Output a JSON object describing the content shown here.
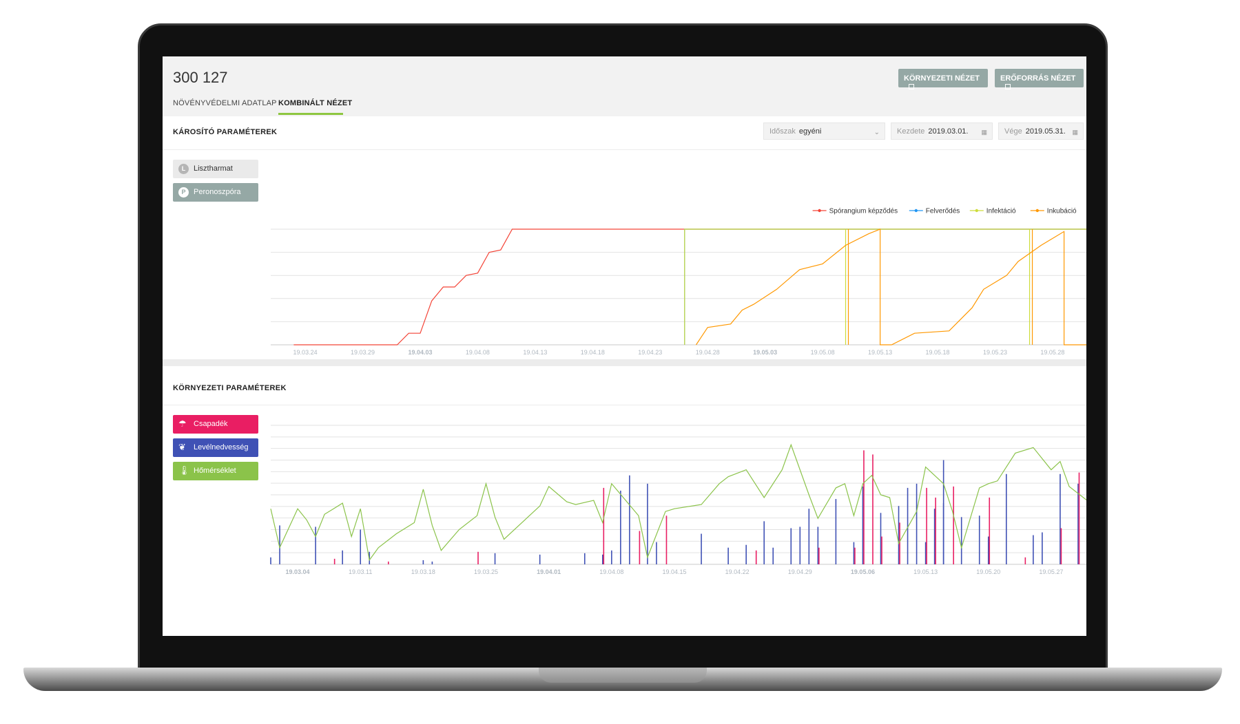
{
  "header": {
    "title": "300 127",
    "tabs": [
      {
        "label": "NÖVÉNYVÉDELMI ADATLAP",
        "active": false
      },
      {
        "label": "KOMBINÁLT NÉZET",
        "active": true
      }
    ],
    "buttons": [
      {
        "label": "KÖRNYEZETI NÉZET",
        "icon": "external-link-icon"
      },
      {
        "label": "ERŐFORRÁS NÉZET",
        "icon": "external-link-icon"
      }
    ]
  },
  "harmful": {
    "title": "KÁROSÍTÓ PARAMÉTEREK",
    "period": {
      "label": "Időszak",
      "value": "egyéni"
    },
    "start": {
      "label": "Kezdete",
      "value": "2019.03.01."
    },
    "end": {
      "label": "Vége",
      "value": "2019.05.31."
    },
    "pathogens": [
      {
        "letter": "L",
        "label": "Lisztharmat"
      },
      {
        "letter": "P",
        "label": "Peronoszpóra"
      }
    ]
  },
  "environment": {
    "title": "KÖRNYEZETI PARAMÉTEREK",
    "params": [
      {
        "label": "Csapadék",
        "icon": "cloud-rain-icon"
      },
      {
        "label": "Levélnedvesség",
        "icon": "leaf-icon"
      },
      {
        "label": "Hőmérséklet",
        "icon": "thermometer-icon"
      }
    ]
  },
  "colors": {
    "accent": "#8dc63f",
    "button_grey": "#95a8a5",
    "sporangium": "#f44336",
    "felverodes": "#2196f3",
    "infekcio": "#cddc39",
    "inkubacio": "#ff9800",
    "csapadek": "#e91e63",
    "levelnedvesseg": "#3f51b5",
    "homerseklet": "#8bc34a"
  },
  "chart_data": [
    {
      "type": "line",
      "x_unit": "date",
      "x_range": [
        "2019-03-21",
        "2019-05-31"
      ],
      "ylim": [
        0,
        100
      ],
      "grid": true,
      "legend_position": "top-right",
      "tick_labels": [
        "19.03.24",
        "19.03.29",
        "19.04.03",
        "19.04.08",
        "19.04.13",
        "19.04.18",
        "19.04.23",
        "19.04.28",
        "19.05.03",
        "19.05.08",
        "19.05.13",
        "19.05.18",
        "19.05.23",
        "19.05.28"
      ],
      "bold_ticks": [
        "19.04.03",
        "19.05.03"
      ],
      "series": [
        {
          "name": "Spórangium képződés",
          "color": "#f44336",
          "points": [
            [
              "2019-03-23",
              0
            ],
            [
              "2019-04-01",
              0
            ],
            [
              "2019-04-02",
              10
            ],
            [
              "2019-04-03",
              10
            ],
            [
              "2019-04-04",
              38
            ],
            [
              "2019-04-05",
              50
            ],
            [
              "2019-04-06",
              50
            ],
            [
              "2019-04-07",
              60
            ],
            [
              "2019-04-08",
              62
            ],
            [
              "2019-04-09",
              80
            ],
            [
              "2019-04-10",
              82
            ],
            [
              "2019-04-11",
              100
            ],
            [
              "2019-05-31",
              100
            ]
          ]
        },
        {
          "name": "Felverődés",
          "color": "#2196f3",
          "points": [
            [
              "2019-04-26",
              0
            ],
            [
              "2019-04-26",
              100
            ],
            [
              "2019-05-31",
              100
            ]
          ]
        },
        {
          "name": "Infektáció",
          "color": "#cddc39",
          "points": [
            [
              "2019-04-26",
              0
            ],
            [
              "2019-04-26",
              100
            ],
            [
              "2019-05-31",
              100
            ]
          ],
          "drops": [
            "2019-05-10",
            "2019-05-26"
          ]
        },
        {
          "name": "Inkubáció",
          "color": "#ff9800",
          "points": [
            [
              "2019-04-27",
              0
            ],
            [
              "2019-04-28",
              15
            ],
            [
              "2019-04-30",
              18
            ],
            [
              "2019-05-01",
              30
            ],
            [
              "2019-05-02",
              35
            ],
            [
              "2019-05-04",
              48
            ],
            [
              "2019-05-06",
              65
            ],
            [
              "2019-05-08",
              70
            ],
            [
              "2019-05-10",
              86
            ],
            [
              "2019-05-12",
              96
            ],
            [
              "2019-05-13",
              100
            ],
            [
              "2019-05-13",
              0
            ],
            [
              "2019-05-14",
              0
            ],
            [
              "2019-05-16",
              10
            ],
            [
              "2019-05-19",
              12
            ],
            [
              "2019-05-21",
              32
            ],
            [
              "2019-05-22",
              48
            ],
            [
              "2019-05-24",
              60
            ],
            [
              "2019-05-25",
              72
            ],
            [
              "2019-05-27",
              86
            ],
            [
              "2019-05-29",
              98
            ],
            [
              "2019-05-29",
              0
            ],
            [
              "2019-05-31",
              0
            ]
          ]
        }
      ]
    },
    {
      "type": "bar",
      "x_unit": "date",
      "x_range": [
        "2019-03-01",
        "2019-05-31"
      ],
      "ylim": [
        0,
        100
      ],
      "grid": true,
      "tick_labels": [
        "19.03.04",
        "19.03.11",
        "19.03.18",
        "19.03.25",
        "19.04.01",
        "19.04.08",
        "19.04.15",
        "19.04.22",
        "19.04.29",
        "19.05.06",
        "19.05.13",
        "19.05.20",
        "19.05.27"
      ],
      "bold_ticks": [
        "19.03.04",
        "19.04.01",
        "19.05.06"
      ],
      "series": [
        {
          "name": "Levélnedvesség",
          "color": "#3f51b5",
          "kind": "bar",
          "points": [
            [
              "2019-03-01",
              5
            ],
            [
              "2019-03-02",
              28
            ],
            [
              "2019-03-06",
              27
            ],
            [
              "2019-03-09",
              10
            ],
            [
              "2019-03-11",
              25
            ],
            [
              "2019-03-12",
              9
            ],
            [
              "2019-03-18",
              3
            ],
            [
              "2019-03-19",
              2
            ],
            [
              "2019-03-26",
              8
            ],
            [
              "2019-03-31",
              7
            ],
            [
              "2019-04-05",
              8
            ],
            [
              "2019-04-07",
              7
            ],
            [
              "2019-04-08",
              10
            ],
            [
              "2019-04-09",
              53
            ],
            [
              "2019-04-10",
              64
            ],
            [
              "2019-04-12",
              58
            ],
            [
              "2019-04-13",
              16
            ],
            [
              "2019-04-18",
              22
            ],
            [
              "2019-04-21",
              12
            ],
            [
              "2019-04-23",
              14
            ],
            [
              "2019-04-25",
              31
            ],
            [
              "2019-04-26",
              12
            ],
            [
              "2019-04-28",
              26
            ],
            [
              "2019-04-29",
              27
            ],
            [
              "2019-04-30",
              40
            ],
            [
              "2019-05-01",
              27
            ],
            [
              "2019-05-03",
              47
            ],
            [
              "2019-05-05",
              16
            ],
            [
              "2019-05-06",
              56
            ],
            [
              "2019-05-08",
              37
            ],
            [
              "2019-05-10",
              42
            ],
            [
              "2019-05-11",
              55
            ],
            [
              "2019-05-12",
              58
            ],
            [
              "2019-05-13",
              16
            ],
            [
              "2019-05-14",
              40
            ],
            [
              "2019-05-15",
              44
            ],
            [
              "2019-05-15",
              75
            ],
            [
              "2019-05-17",
              34
            ],
            [
              "2019-05-19",
              35
            ],
            [
              "2019-05-20",
              20
            ],
            [
              "2019-05-22",
              65
            ],
            [
              "2019-05-25",
              21
            ],
            [
              "2019-05-26",
              23
            ],
            [
              "2019-05-28",
              65
            ],
            [
              "2019-05-30",
              58
            ],
            [
              "2019-05-31",
              67
            ]
          ]
        },
        {
          "name": "Csapadék",
          "color": "#e91e63",
          "kind": "bar",
          "points": [
            [
              "2019-03-08",
              4
            ],
            [
              "2019-03-14",
              2
            ],
            [
              "2019-03-24",
              9
            ],
            [
              "2019-04-07",
              55
            ],
            [
              "2019-04-11",
              24
            ],
            [
              "2019-04-14",
              35
            ],
            [
              "2019-04-24",
              10
            ],
            [
              "2019-05-01",
              12
            ],
            [
              "2019-05-05",
              12
            ],
            [
              "2019-05-06",
              82
            ],
            [
              "2019-05-07",
              79
            ],
            [
              "2019-05-08",
              20
            ],
            [
              "2019-05-10",
              30
            ],
            [
              "2019-05-13",
              55
            ],
            [
              "2019-05-14",
              48
            ],
            [
              "2019-05-16",
              56
            ],
            [
              "2019-05-20",
              48
            ],
            [
              "2019-05-24",
              5
            ],
            [
              "2019-05-28",
              26
            ],
            [
              "2019-05-30",
              66
            ]
          ]
        },
        {
          "name": "Hőmérséklet",
          "color": "#8bc34a",
          "kind": "line",
          "points": [
            [
              "2019-03-01",
              40
            ],
            [
              "2019-03-02",
              12
            ],
            [
              "2019-03-04",
              40
            ],
            [
              "2019-03-05",
              32
            ],
            [
              "2019-03-06",
              20
            ],
            [
              "2019-03-07",
              36
            ],
            [
              "2019-03-08",
              40
            ],
            [
              "2019-03-09",
              44
            ],
            [
              "2019-03-10",
              20
            ],
            [
              "2019-03-11",
              40
            ],
            [
              "2019-03-12",
              3
            ],
            [
              "2019-03-13",
              12
            ],
            [
              "2019-03-15",
              22
            ],
            [
              "2019-03-17",
              30
            ],
            [
              "2019-03-18",
              54
            ],
            [
              "2019-03-19",
              28
            ],
            [
              "2019-03-20",
              10
            ],
            [
              "2019-03-22",
              25
            ],
            [
              "2019-03-24",
              35
            ],
            [
              "2019-03-25",
              58
            ],
            [
              "2019-03-26",
              34
            ],
            [
              "2019-03-27",
              18
            ],
            [
              "2019-03-29",
              30
            ],
            [
              "2019-03-31",
              42
            ],
            [
              "2019-04-01",
              56
            ],
            [
              "2019-04-03",
              45
            ],
            [
              "2019-04-04",
              43
            ],
            [
              "2019-04-06",
              46
            ],
            [
              "2019-04-07",
              30
            ],
            [
              "2019-04-08",
              58
            ],
            [
              "2019-04-11",
              35
            ],
            [
              "2019-04-12",
              5
            ],
            [
              "2019-04-14",
              38
            ],
            [
              "2019-04-15",
              40
            ],
            [
              "2019-04-18",
              43
            ],
            [
              "2019-04-20",
              58
            ],
            [
              "2019-04-21",
              63
            ],
            [
              "2019-04-23",
              68
            ],
            [
              "2019-04-25",
              48
            ],
            [
              "2019-04-27",
              68
            ],
            [
              "2019-04-28",
              86
            ],
            [
              "2019-04-30",
              50
            ],
            [
              "2019-05-01",
              33
            ],
            [
              "2019-05-03",
              55
            ],
            [
              "2019-05-04",
              58
            ],
            [
              "2019-05-05",
              35
            ],
            [
              "2019-05-06",
              58
            ],
            [
              "2019-05-07",
              64
            ],
            [
              "2019-05-08",
              50
            ],
            [
              "2019-05-09",
              48
            ],
            [
              "2019-05-10",
              15
            ],
            [
              "2019-05-12",
              38
            ],
            [
              "2019-05-13",
              70
            ],
            [
              "2019-05-15",
              58
            ],
            [
              "2019-05-16",
              38
            ],
            [
              "2019-05-17",
              12
            ],
            [
              "2019-05-19",
              55
            ],
            [
              "2019-05-20",
              58
            ],
            [
              "2019-05-21",
              60
            ],
            [
              "2019-05-23",
              80
            ],
            [
              "2019-05-25",
              84
            ],
            [
              "2019-05-27",
              68
            ],
            [
              "2019-05-28",
              74
            ],
            [
              "2019-05-29",
              56
            ],
            [
              "2019-05-31",
              46
            ]
          ]
        }
      ]
    }
  ]
}
